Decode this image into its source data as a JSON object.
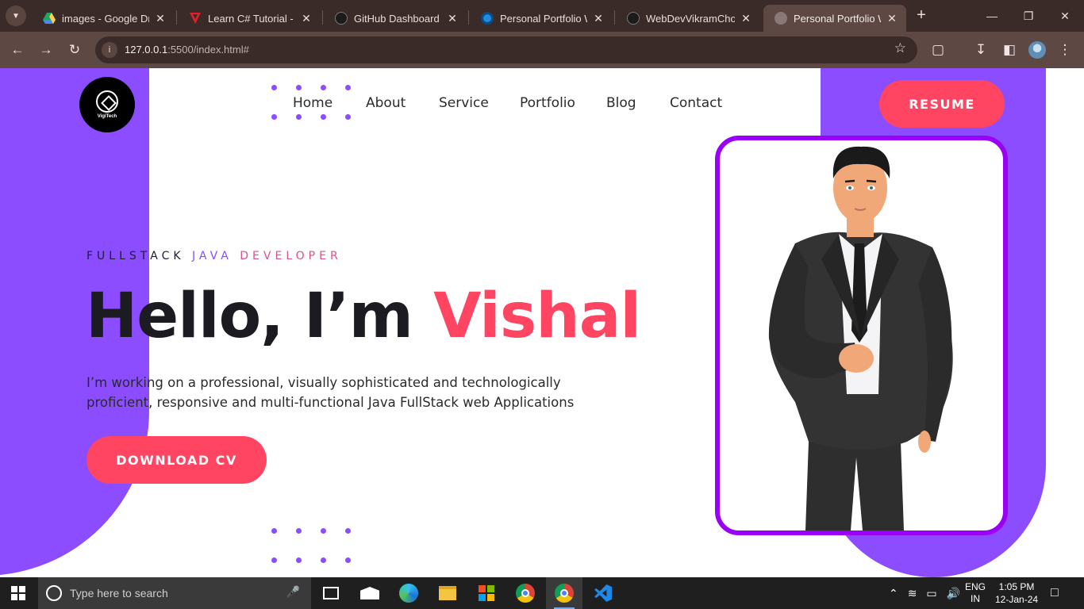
{
  "browser": {
    "tabs": [
      {
        "title": "images - Google Drive",
        "favicon": "google-drive-icon",
        "active": false
      },
      {
        "title": "Learn C# Tutorial - javatpoint",
        "favicon": "javatpoint-icon",
        "active": false
      },
      {
        "title": "GitHub Dashboard",
        "favicon": "github-icon",
        "active": false
      },
      {
        "title": "Personal Portfolio Website",
        "favicon": "portfolio-icon",
        "active": false
      },
      {
        "title": "WebDevVikramChoudhary",
        "favicon": "github-icon",
        "active": false
      },
      {
        "title": "Personal Portfolio Website",
        "favicon": "globe-icon",
        "active": true
      }
    ],
    "url_host": "127.0.0.1",
    "url_path": ":5500/index.html#"
  },
  "site": {
    "logo_text": "VigiTech",
    "nav": [
      "Home",
      "About",
      "Service",
      "Portfolio",
      "Blog",
      "Contact"
    ],
    "resume_label": "RESUME",
    "subtitle": {
      "part1": "FULLSTACK ",
      "part2": "JAVA ",
      "part3": "DEVELOPER"
    },
    "headline": {
      "prefix": "Hello, I’m ",
      "name": "Vishal"
    },
    "description": "I’m working on a professional, visually sophisticated and technologically proficient, responsive and multi-functional Java FullStack web Applications",
    "download_label": "DOWNLOAD CV",
    "colors": {
      "accent_purple": "#8b4dff",
      "accent_pink": "#ff4561",
      "card_border": "#9a00f5"
    }
  },
  "taskbar": {
    "search_placeholder": "Type here to search",
    "lang_top": "ENG",
    "lang_bottom": "IN",
    "time": "1:05 PM",
    "date": "12-Jan-24"
  }
}
